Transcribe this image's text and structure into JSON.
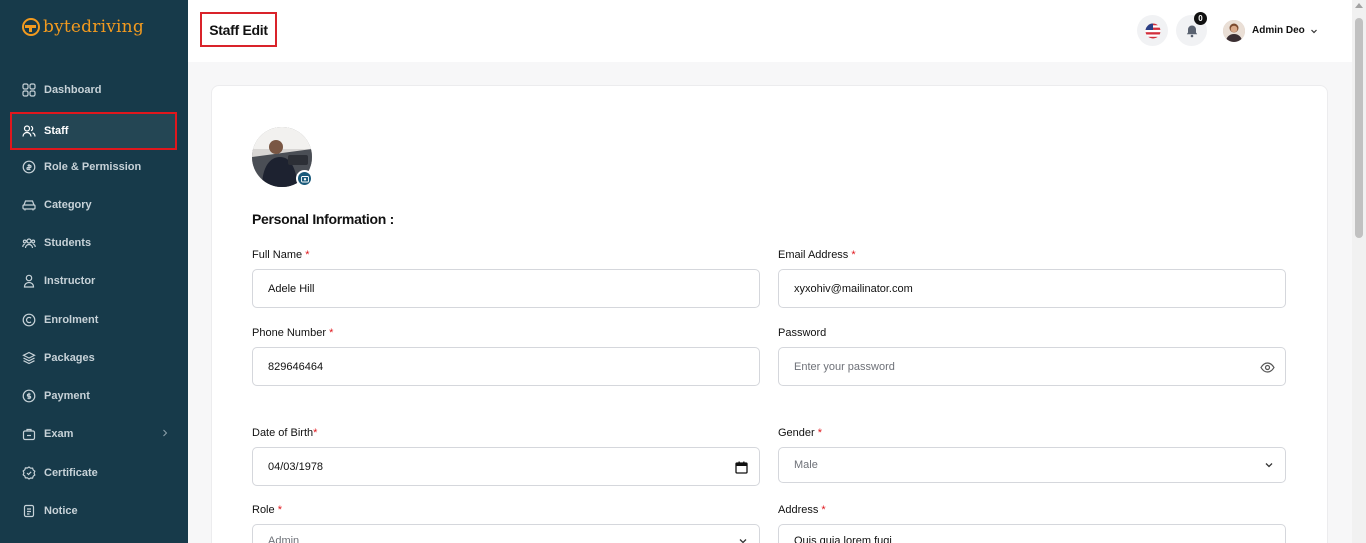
{
  "brand": {
    "name": "bytedriving",
    "accent": "#f29a1f"
  },
  "sidebar": {
    "items": [
      {
        "label": "Dashboard",
        "icon": "grid-icon"
      },
      {
        "label": "Staff",
        "icon": "users-icon"
      },
      {
        "label": "Role & Permission",
        "icon": "shield-icon"
      },
      {
        "label": "Category",
        "icon": "car-icon"
      },
      {
        "label": "Students",
        "icon": "group-icon"
      },
      {
        "label": "Instructor",
        "icon": "person-icon"
      },
      {
        "label": "Enrolment",
        "icon": "copyright-icon"
      },
      {
        "label": "Packages",
        "icon": "layers-icon"
      },
      {
        "label": "Payment",
        "icon": "dollar-icon"
      },
      {
        "label": "Exam",
        "icon": "briefcase-icon"
      },
      {
        "label": "Certificate",
        "icon": "badge-icon"
      },
      {
        "label": "Notice",
        "icon": "document-icon"
      }
    ],
    "active": "Staff",
    "bg_color": "#173a4a",
    "active_border_color": "#e0171d"
  },
  "header": {
    "title": "Staff Edit",
    "notifications_count": "0",
    "user_name": "Admin Deo"
  },
  "form": {
    "section_title": "Personal Information :",
    "required_mark": "*",
    "full_name": {
      "label": "Full Name",
      "value": "Adele Hill"
    },
    "email": {
      "label": "Email Address",
      "value": "xyxohiv@mailinator.com"
    },
    "phone": {
      "label": "Phone Number",
      "value": "829646464"
    },
    "password": {
      "label": "Password",
      "placeholder": "Enter your password"
    },
    "dob": {
      "label": "Date of Birth",
      "value": "04/03/1978"
    },
    "gender": {
      "label": "Gender",
      "value": "Male"
    },
    "role": {
      "label": "Role",
      "value": "Admin"
    },
    "address": {
      "label": "Address",
      "value": "Quis quia lorem fugi"
    }
  }
}
